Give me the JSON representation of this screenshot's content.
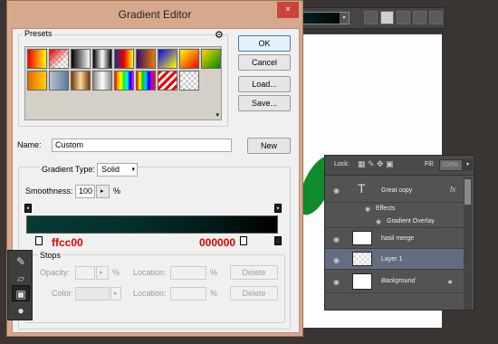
{
  "dialog": {
    "title": "Gradient Editor",
    "close_icon": "×"
  },
  "presets": {
    "label": "Presets",
    "gear_icon": "⚙"
  },
  "buttons": {
    "ok": "OK",
    "cancel": "Cancel",
    "load": "Load...",
    "save": "Save...",
    "new": "New"
  },
  "name": {
    "label": "Name:",
    "value": "Custom"
  },
  "gradient_type": {
    "label": "Gradient Type:",
    "value": "Solid"
  },
  "smoothness": {
    "label": "Smoothness:",
    "value": "100",
    "unit": "%"
  },
  "annotations": {
    "left_color": "ffcc00",
    "right_color": "000000"
  },
  "stops": {
    "label": "Stops",
    "opacity_label": "Opacity:",
    "opacity_unit": "%",
    "location_label": "Location:",
    "location_unit": "%",
    "color_label": "Color:",
    "delete": "Delete"
  },
  "colors": {
    "gradient_start": "#083a35",
    "gradient_end": "#000000",
    "annotation": "#e00000",
    "selected_layer": "#636d80"
  },
  "layers_panel": {
    "lock_label": "Lock:",
    "fill_label": "Fill:",
    "fill_value": "100%",
    "layers": [
      {
        "name": "Great copy",
        "fx": "fx"
      },
      {
        "name": "Effects"
      },
      {
        "name": "Gradient Overlay"
      },
      {
        "name": "hasil merge"
      },
      {
        "name": "Layer 1"
      },
      {
        "name": "Background"
      }
    ]
  }
}
